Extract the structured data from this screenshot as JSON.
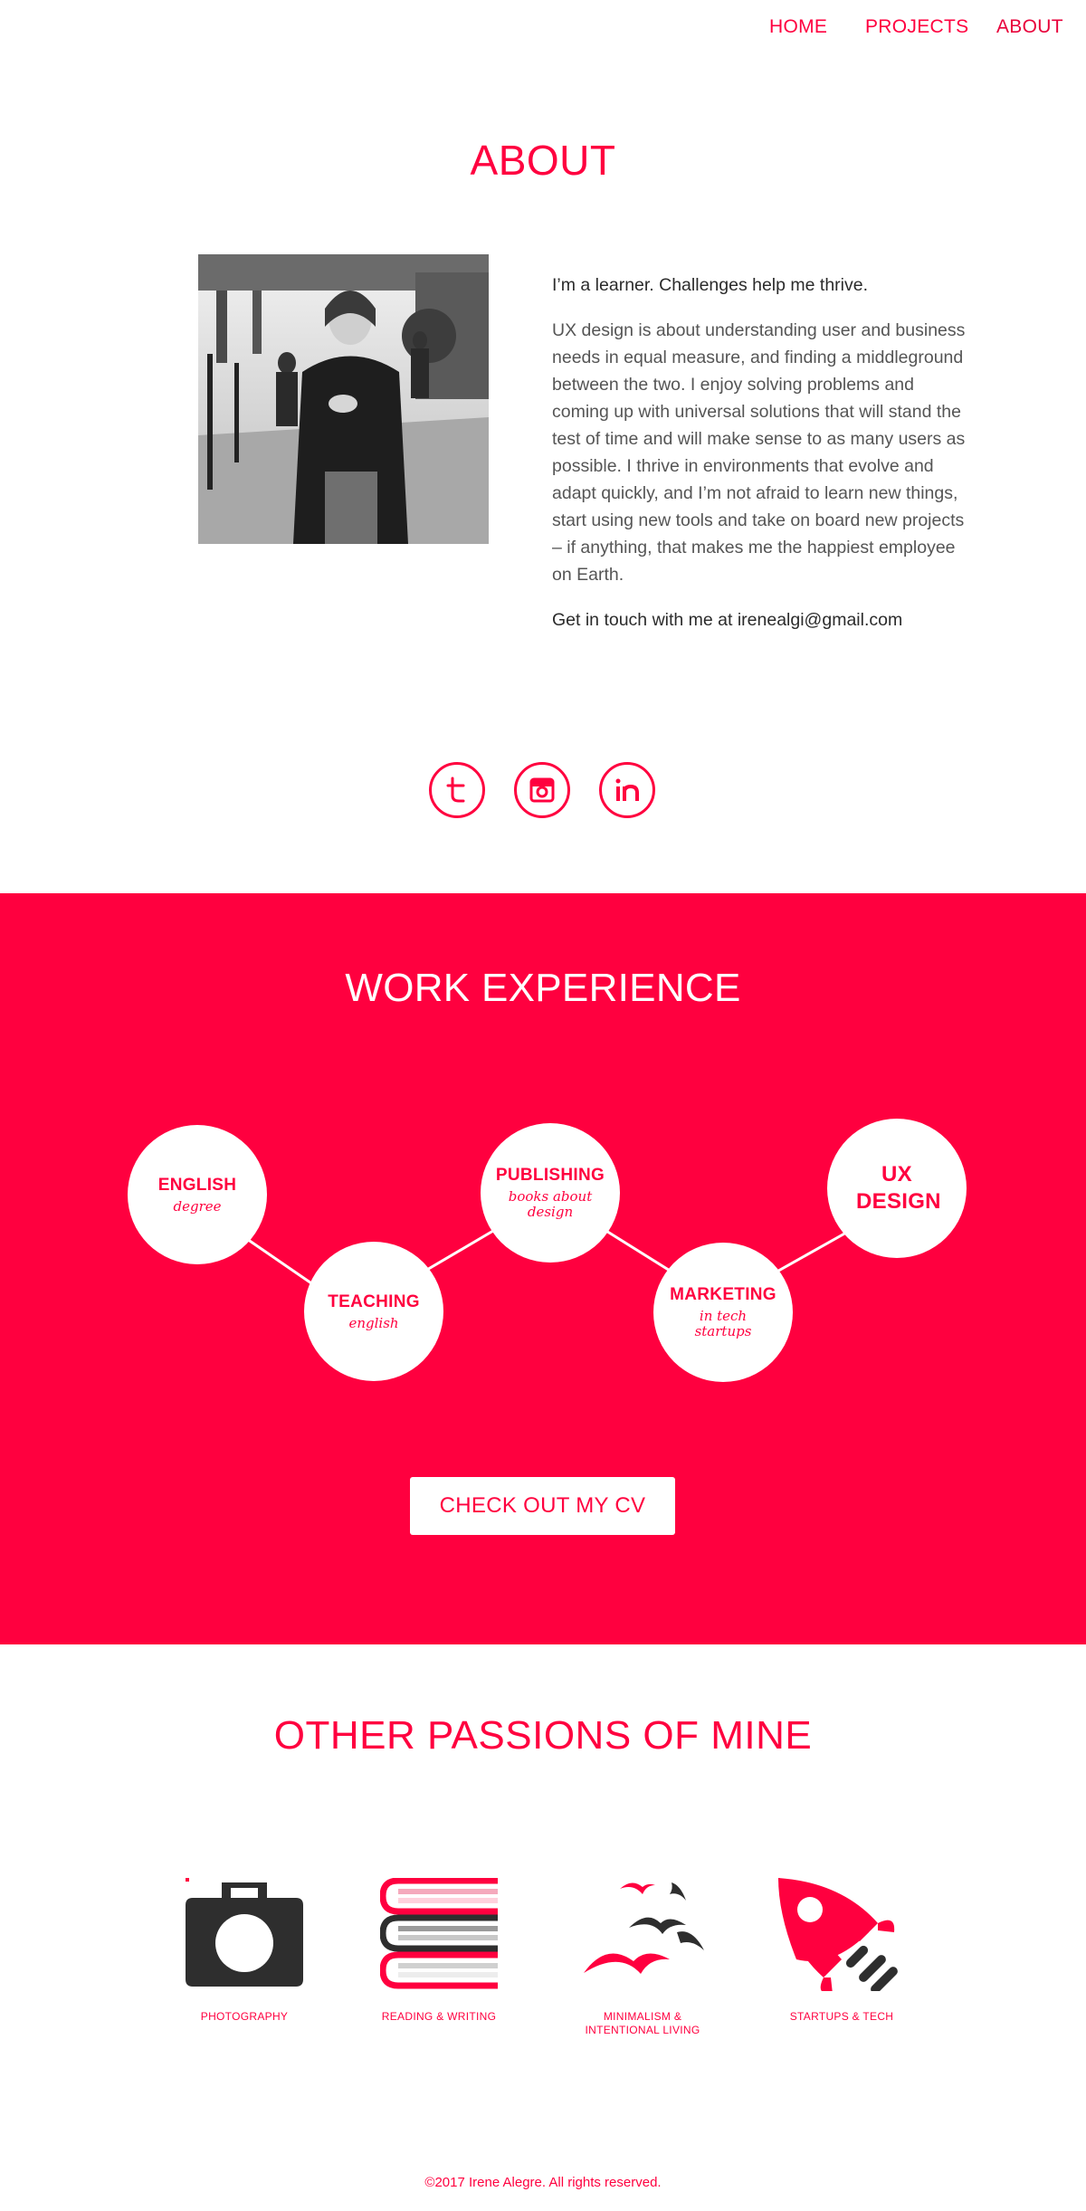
{
  "nav": {
    "home": "HOME",
    "projects": "PROJECTS",
    "about": "ABOUT"
  },
  "about": {
    "title": "ABOUT",
    "lead": "I’m a learner. Challenges help me thrive.",
    "body": "UX design is about understanding user and business needs in equal measure, and finding a middleground between the two. I enjoy solving problems and coming up with universal solutions that will stand the test of time and will make sense to as many users as possible. I thrive in environments that evolve and adapt quickly, and I’m not afraid to learn new things, start using new tools and take on board new projects – if anything, that makes me the happiest employee on Earth.",
    "contact": "Get in touch with me at irenealgi@gmail.com"
  },
  "socials": [
    {
      "name": "twitter",
      "icon": "twitter-icon"
    },
    {
      "name": "instagram",
      "icon": "instagram-icon"
    },
    {
      "name": "linkedin",
      "icon": "linkedin-icon"
    }
  ],
  "work": {
    "title": "WORK EXPERIENCE",
    "nodes": [
      {
        "title": "ENGLISH",
        "sub": "degree"
      },
      {
        "title": "TEACHING",
        "sub": "english"
      },
      {
        "title": "PUBLISHING",
        "sub": "books about design"
      },
      {
        "title": "MARKETING",
        "sub": "in tech startups"
      },
      {
        "title": "UX DESIGN",
        "sub": ""
      }
    ],
    "cv_button": "CHECK OUT MY CV"
  },
  "passions": {
    "title": "OTHER PASSIONS OF MINE",
    "items": [
      {
        "label": "PHOTOGRAPHY",
        "icon": "camera-icon"
      },
      {
        "label": "READING & WRITING",
        "icon": "books-icon"
      },
      {
        "label": "MINIMALISM & INTENTIONAL LIVING",
        "icon": "birds-icon"
      },
      {
        "label": "STARTUPS & TECH",
        "icon": "rocket-icon"
      }
    ]
  },
  "footer": "©2017 Irene Alegre. All rights reserved.",
  "colors": {
    "accent": "#ff003f",
    "text": "#2b2b2b",
    "dark_icon": "#2e2e2e"
  }
}
